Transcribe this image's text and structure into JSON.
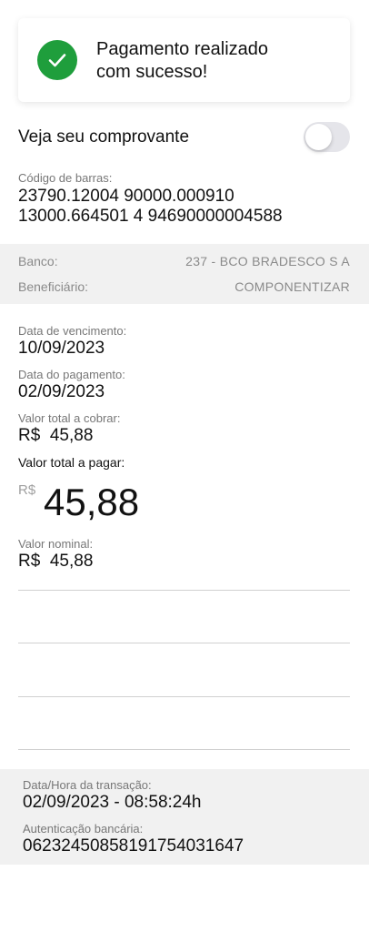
{
  "success": {
    "icon": "check-icon",
    "icon_color": "#1f9e3c",
    "line1": "Pagamento realizado",
    "line2": "com sucesso!"
  },
  "receipt_toggle": {
    "label": "Veja seu comprovante",
    "on": false
  },
  "barcode": {
    "label": "Código de barras:",
    "line1": "23790.12004 90000.000910",
    "line2": "13000.664501 4 94690000004588"
  },
  "bank_info": {
    "bank_label": "Banco:",
    "bank_value": "237 - BCO BRADESCO S A",
    "beneficiary_label": "Beneficiário:",
    "beneficiary_value": "COMPONENTIZAR"
  },
  "details": {
    "due_date_label": "Data de vencimento:",
    "due_date_value": "10/09/2023",
    "payment_date_label": "Data do pagamento:",
    "payment_date_value": "02/09/2023",
    "total_charge_label": "Valor total a cobrar:",
    "total_charge_value": "R$  45,88",
    "total_pay_label": "Valor total a pagar:",
    "total_pay_currency": "R$",
    "total_pay_amount": "45,88",
    "nominal_label": "Valor nominal:",
    "nominal_value": "R$  45,88"
  },
  "transaction": {
    "datetime_label": "Data/Hora da transação:",
    "datetime_value": "02/09/2023 - 08:58:24h",
    "auth_label": "Autenticação bancária:",
    "auth_value": "0623245085819175403164​7"
  }
}
